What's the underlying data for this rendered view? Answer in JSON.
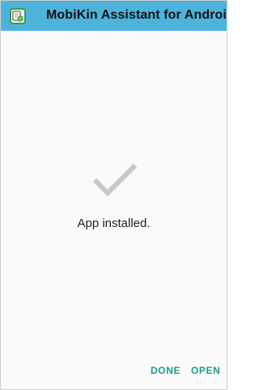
{
  "app_bar": {
    "title": "MobiKin Assistant for Android",
    "icon": "mobikin-app-icon",
    "background_color": "#4eb3db"
  },
  "status": {
    "icon": "checkmark-icon",
    "icon_color": "#c4c8cb",
    "message": "App installed."
  },
  "actions": {
    "done_label": "DONE",
    "open_label": "OPEN",
    "accent_color": "#1d9a8e"
  }
}
